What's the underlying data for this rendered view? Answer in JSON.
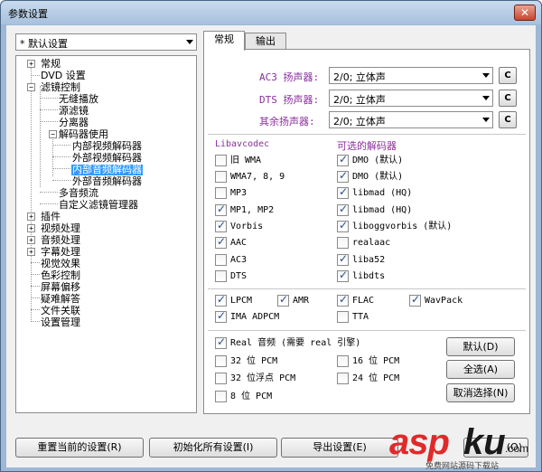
{
  "window": {
    "title": "参数设置",
    "close_glyph": "✕"
  },
  "profile_combo": {
    "value": "* 默认设置"
  },
  "tree": {
    "items": [
      "常规",
      "DVD 设置",
      "滤镜控制",
      "无缝播放",
      "源滤镜",
      "分离器",
      "解码器使用",
      "内部视频解码器",
      "外部视频解码器",
      "内部音频解码器",
      "外部音频解码器",
      "多音频流",
      "自定义滤镜管理器",
      "插件",
      "视频处理",
      "音频处理",
      "字幕处理",
      "视觉效果",
      "色彩控制",
      "屏幕偏移",
      "疑难解答",
      "文件关联",
      "设置管理"
    ],
    "selected": "内部音频解码器",
    "expand_glyph": "+",
    "collapse_glyph": "−"
  },
  "tabs": [
    {
      "label": "常规",
      "active": true
    },
    {
      "label": "输出",
      "active": false
    }
  ],
  "speakers": [
    {
      "label": "AC3 扬声器:",
      "value": "2/0; 立体声",
      "button": "C"
    },
    {
      "label": "DTS 扬声器:",
      "value": "2/0; 立体声",
      "button": "C"
    },
    {
      "label": "其余扬声器:",
      "value": "2/0; 立体声",
      "button": "C"
    }
  ],
  "libavcodec": {
    "heading": "Libavcodec",
    "items": [
      {
        "label": "旧 WMA",
        "checked": false
      },
      {
        "label": "WMA7, 8, 9",
        "checked": false
      },
      {
        "label": "MP3",
        "checked": false
      },
      {
        "label": "MP1, MP2",
        "checked": true
      },
      {
        "label": "Vorbis",
        "checked": true
      },
      {
        "label": "AAC",
        "checked": true
      },
      {
        "label": "AC3",
        "checked": false
      },
      {
        "label": "DTS",
        "checked": false
      }
    ]
  },
  "optional_decoders": {
    "heading": "可选的解码器",
    "items": [
      {
        "label": "DMO (默认)",
        "checked": true
      },
      {
        "label": "DMO (默认)",
        "checked": true
      },
      {
        "label": "libmad (HQ)",
        "checked": true
      },
      {
        "label": "libmad (HQ)",
        "checked": true
      },
      {
        "label": "liboggvorbis (默认)",
        "checked": true
      },
      {
        "label": "realaac",
        "checked": false
      },
      {
        "label": "liba52",
        "checked": true
      },
      {
        "label": "libdts",
        "checked": true
      }
    ]
  },
  "formats": [
    {
      "label": "LPCM",
      "checked": true
    },
    {
      "label": "AMR",
      "checked": true
    },
    {
      "label": "FLAC",
      "checked": true
    },
    {
      "label": "WavPack",
      "checked": true
    },
    {
      "label": "IMA ADPCM",
      "checked": true
    },
    {
      "label": "TTA",
      "checked": false
    }
  ],
  "pcm": [
    {
      "label": "Real 音频 (需要 real 引擎)",
      "checked": true
    },
    {
      "label": "32 位 PCM",
      "checked": false
    },
    {
      "label": "16 位 PCM",
      "checked": false
    },
    {
      "label": "32 位浮点 PCM",
      "checked": false
    },
    {
      "label": "24 位 PCM",
      "checked": false
    },
    {
      "label": "8 位 PCM",
      "checked": false
    }
  ],
  "side_buttons": {
    "default": "默认(D)",
    "select_all": "全选(A)",
    "deselect": "取消选择(N)"
  },
  "bottom_buttons": {
    "reset": "重置当前的设置(R)",
    "init_all": "初始化所有设置(I)",
    "export": "导出设置(E)",
    "fourth": "(O)"
  },
  "watermark": {
    "asp": "asp",
    "ku": "ku",
    "com": ".com",
    "sub": "免费网站源码下载站"
  },
  "colors": {
    "label_accent": "#8a2f9e",
    "selection": "#3399ff",
    "watermark_red": "#e02a2a"
  }
}
